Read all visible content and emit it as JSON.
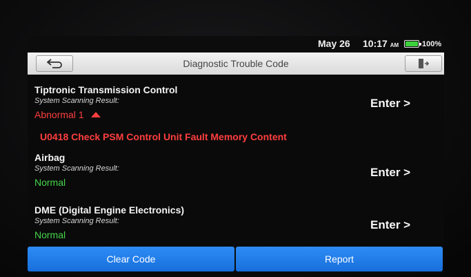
{
  "status": {
    "date": "May 26",
    "time": "10:17",
    "ampm": "AM",
    "battery": "100%",
    "battery_color": "#3bd13b"
  },
  "header": {
    "title": "Diagnostic Trouble Code",
    "back_icon": "back-arrow-icon",
    "exit_icon": "exit-door-icon"
  },
  "systems": [
    {
      "name": "Tiptronic Transmission Control",
      "subtitle": "System Scanning Result:",
      "result": "Abnormal 1",
      "result_color": "#ff3e3e",
      "fault": "U0418 Check PSM Control Unit Fault Memory Content",
      "enter": "Enter >"
    },
    {
      "name": "Airbag",
      "subtitle": "System Scanning Result:",
      "result": "Normal",
      "result_color": "#45d64b",
      "enter": "Enter >"
    },
    {
      "name": "DME (Digital Engine Electronics)",
      "subtitle": "System Scanning Result:",
      "result": "Normal",
      "result_color": "#45d64b",
      "enter": "Enter >"
    }
  ],
  "footer": {
    "clear_label": "Clear Code",
    "report_label": "Report",
    "accent": "#2e8cf5"
  }
}
